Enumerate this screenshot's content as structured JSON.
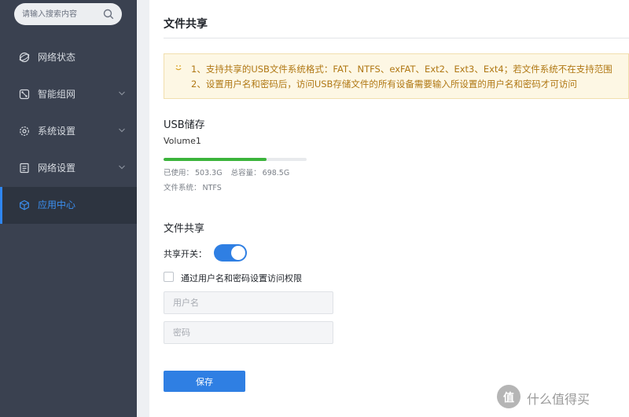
{
  "sidebar": {
    "search_placeholder": "请输入搜索内容",
    "items": [
      {
        "label": "网络状态",
        "icon": "globe-icon",
        "has_submenu": false,
        "active": false
      },
      {
        "label": "智能组网",
        "icon": "network-icon",
        "has_submenu": true,
        "active": false
      },
      {
        "label": "系统设置",
        "icon": "gear-icon",
        "has_submenu": true,
        "active": false
      },
      {
        "label": "网络设置",
        "icon": "document-icon",
        "has_submenu": true,
        "active": false
      },
      {
        "label": "应用中心",
        "icon": "cube-icon",
        "has_submenu": false,
        "active": true
      }
    ]
  },
  "main": {
    "title": "文件共享",
    "notice": {
      "icon": "smile-icon",
      "line1": "1、支持共享的USB文件系统格式：FAT、NTFS、exFAT、Ext2、Ext3、Ext4；若文件系统不在支持范围",
      "line2": "2、设置用户名和密码后，访问USB存储文件的所有设备需要输入所设置的用户名和密码才可访问"
    },
    "usb": {
      "section_title": "USB储存",
      "volume_name": "Volume1",
      "used_fraction": 0.72,
      "used_label": "已使用：",
      "used_value": "503.3G",
      "total_label": "总容量：",
      "total_value": "698.5G",
      "fs_label": "文件系统：",
      "fs_value": "NTFS"
    },
    "share": {
      "section_title": "文件共享",
      "switch_label": "共享开关：",
      "switch_on": true,
      "checkbox_label": "通过用户名和密码设置访问权限",
      "username_placeholder": "用户名",
      "password_placeholder": "密码",
      "save_label": "保存"
    }
  },
  "watermark": {
    "badge": "值",
    "text": "什么值得买"
  },
  "colors": {
    "sidebar_bg": "#3a4150",
    "accent": "#2f7fe3",
    "progress": "#3cb43c",
    "notice_text": "#b07814"
  }
}
